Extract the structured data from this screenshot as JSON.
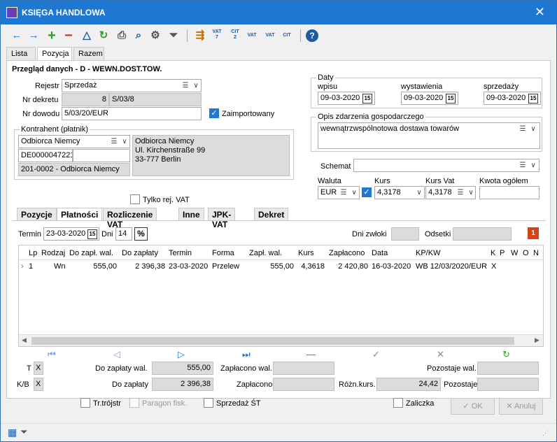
{
  "window": {
    "title": "KSIĘGA HANDLOWA",
    "close": "✕"
  },
  "toolbar": {
    "vat1": "VAT",
    "vat1b": "7",
    "cit1": "CIT",
    "cit1b": "2",
    "vat2": "VAT",
    "vat3": "VAT",
    "cit2": "CIT"
  },
  "tabs_top": [
    "Lista",
    "Pozycja",
    "Razem"
  ],
  "header": {
    "title": "Przegląd danych - D - WEWN.DOST.TOW."
  },
  "form": {
    "rejestr_label": "Rejestr",
    "rejestr_value": "Sprzedaż",
    "nr_dekretu_label": "Nr dekretu",
    "nr_dekretu_num": "8",
    "nr_dekretu_code": "S/03/8",
    "nr_dowodu_label": "Nr dowodu",
    "nr_dowodu_value": "5/03/20/EUR",
    "zaimportowany_label": "Zaimportowany",
    "kontrahent_group": "Kontrahent (płatnik)",
    "kontrahent_name": "Odbiorca Niemcy",
    "kontrahent_nip": "DE0000047221",
    "kontrahent_account": "201-0002 - Odbiorca Niemcy",
    "kontrahent_addr1": "Odbiorca Niemcy",
    "kontrahent_addr2": "Ul. Kirchenstraße 99",
    "kontrahent_addr3": "33-777 Berlin",
    "tylko_vat_label": "Tylko rej. VAT",
    "daty_group": "Daty",
    "wpisu_label": "wpisu",
    "wpisu_value": "09-03-2020",
    "wystawienia_label": "wystawienia",
    "wystawienia_value": "09-03-2020",
    "sprzedazy_label": "sprzedaży",
    "sprzedazy_value": "09-03-2020",
    "opis_group": "Opis zdarzenia gospodarczego",
    "opis_value": "wewnątrzwspólnotowa dostawa towarów",
    "schemat_label": "Schemat",
    "schemat_value": "",
    "waluta_label": "Waluta",
    "waluta_value": "EUR",
    "kurs_label": "Kurs",
    "kurs_value": "4,3178",
    "kurs_vat_label": "Kurs Vat",
    "kurs_vat_value": "4,3178",
    "kwota_label": "Kwota ogółem",
    "kwota_value": ""
  },
  "tabs_bottom": [
    "Pozycje",
    "Płatności",
    "Rozliczenie VAT",
    "Inne",
    "JPK-VAT",
    "Dekret"
  ],
  "platnosci": {
    "termin_label": "Termin",
    "termin_value": "23-03-2020",
    "dni_label": "Dni",
    "dni_value": "14",
    "dni_zwloki_label": "Dni zwłoki",
    "odsetki_label": "Odsetki"
  },
  "grid": {
    "columns": [
      "Lp",
      "Rodzaj",
      "Do zapł. wal.",
      "Do zapłaty",
      "Termin",
      "Forma",
      "Zapł. wal.",
      "Kurs",
      "Zapłacono",
      "Data",
      "KP/KW",
      "K",
      "P",
      "W",
      "O",
      "N"
    ],
    "row": {
      "lp": "1",
      "rodzaj": "Wn",
      "do_zapl_wal": "555,00",
      "do_zaplaty": "2 396,38",
      "termin": "23-03-2020",
      "forma": "Przelew",
      "zapl_wal": "555,00",
      "kurs": "4,3618",
      "zaplacono": "2 420,80",
      "data": "16-03-2020",
      "kpkw": "WB 12/03/2020/EUR",
      "k": "X"
    }
  },
  "totals": {
    "t_label": "T",
    "t_value": "X",
    "kb_label": "K/B",
    "kb_value": "X",
    "do_zapl_wal_label": "Do zapłaty wal.",
    "do_zapl_wal_value": "555,00",
    "do_zaplaty_label": "Do zapłaty",
    "do_zaplaty_value": "2 396,38",
    "zaplacono_wal_label": "Zapłacono wal.",
    "zaplacono_label": "Zapłacono",
    "pozostaje_wal_label": "Pozostaje wal.",
    "pozostaje_label": "Pozostaje",
    "rozn_kurs_label": "Różn.kurs.",
    "rozn_kurs_value": "24,42"
  },
  "footer": {
    "tr_trojstr": "Tr.trójstr",
    "paragon": "Paragon fisk.",
    "sprzedaz_st": "Sprzedaż ŚT",
    "zaliczka": "Zaliczka",
    "ok": "OK",
    "anuluj": "Anuluj"
  },
  "colors": {
    "titlebar": "#1e78d2",
    "accent": "#1f78d2"
  }
}
